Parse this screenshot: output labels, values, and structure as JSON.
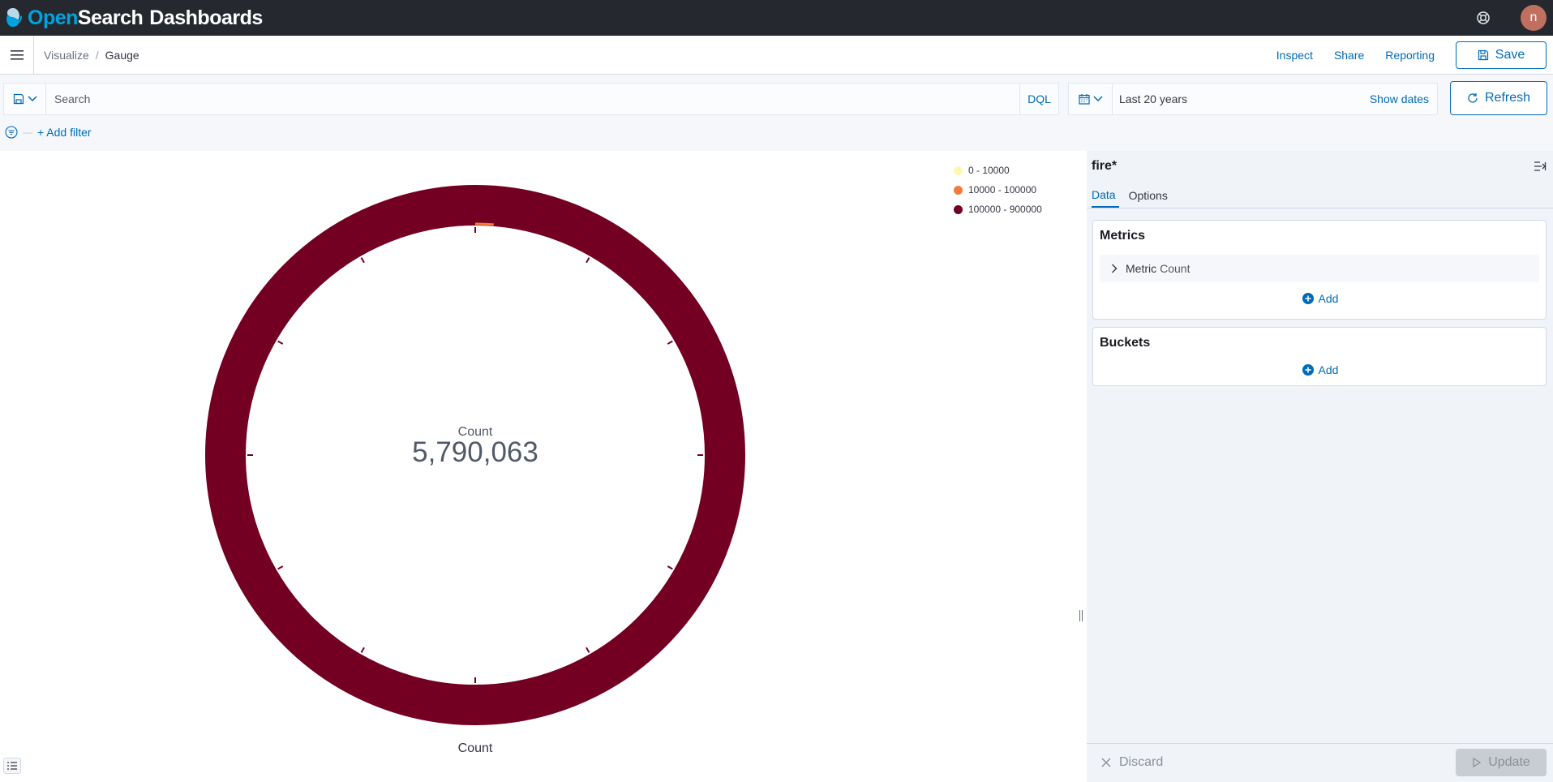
{
  "topbar": {
    "brand_open": "Open",
    "brand_search": "Search",
    "brand_dashboards": "Dashboards",
    "help_icon": "help-icon",
    "avatar_initial": "n"
  },
  "appbar": {
    "menu_icon": "hamburger-icon",
    "breadcrumbs": [
      "Visualize",
      "Gauge"
    ],
    "inspect_label": "Inspect",
    "share_label": "Share",
    "reporting_label": "Reporting",
    "save_label": "Save"
  },
  "query": {
    "search_placeholder": "Search",
    "search_value": "",
    "language": "DQL",
    "date_range": "Last 20 years",
    "show_dates_label": "Show dates",
    "refresh_label": "Refresh",
    "add_filter_label": "+ Add filter"
  },
  "visualization": {
    "type": "gauge",
    "metric_label": "Count",
    "metric_value": "5,790,063",
    "sub_label": "Count",
    "legend": [
      {
        "label": "0 - 10000",
        "color": "#fef6b3"
      },
      {
        "label": "10000 - 100000",
        "color": "#f47b3c"
      },
      {
        "label": "100000 - 900000",
        "color": "#730022"
      }
    ]
  },
  "sidebar": {
    "index_pattern": "fire*",
    "tabs": [
      {
        "label": "Data",
        "active": true
      },
      {
        "label": "Options",
        "active": false
      }
    ],
    "metrics": {
      "title": "Metrics",
      "items": [
        {
          "label": "Metric",
          "type": "Count"
        }
      ],
      "add_label": "Add"
    },
    "buckets": {
      "title": "Buckets",
      "add_label": "Add"
    },
    "discard_label": "Discard",
    "update_label": "Update"
  },
  "colors": {
    "accent": "#006bb8",
    "header": "#25282f",
    "gauge_fill": "#730022"
  }
}
